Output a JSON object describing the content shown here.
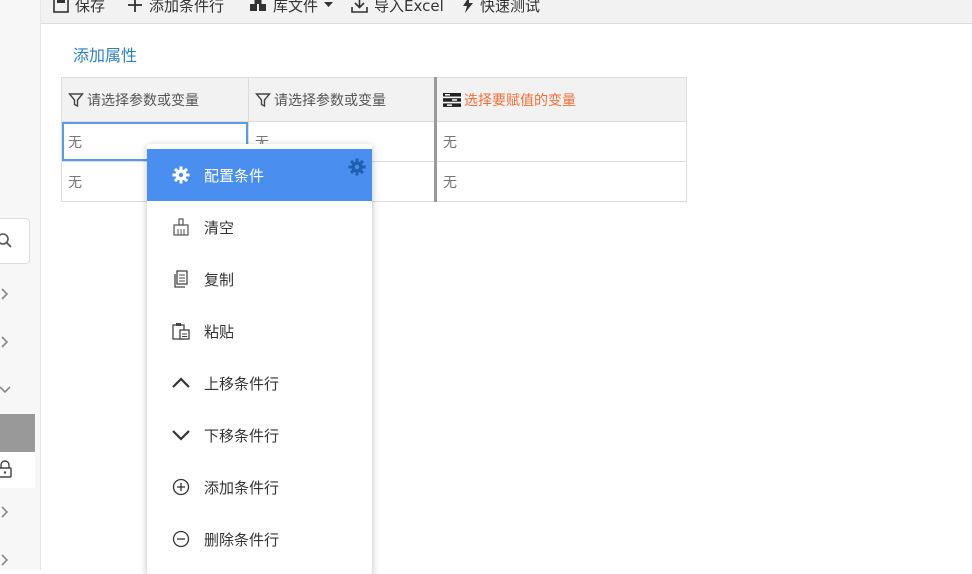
{
  "toolbar": {
    "save": "保存",
    "add_condition_row": "添加条件行",
    "library_file": "库文件",
    "import_excel": "导入Excel",
    "quick_test": "快速测试"
  },
  "add_attribute_link": "添加属性",
  "table": {
    "headers": [
      "请选择参数或变量",
      "请选择参数或变量",
      "选择要赋值的变量"
    ],
    "rows": [
      [
        "无",
        "无",
        "无"
      ],
      [
        "无",
        "",
        "无"
      ]
    ]
  },
  "context_menu": {
    "items": [
      {
        "label": "配置条件",
        "icon": "gear-icon",
        "active": true
      },
      {
        "label": "清空",
        "icon": "broom-icon"
      },
      {
        "label": "复制",
        "icon": "copy-icon"
      },
      {
        "label": "粘贴",
        "icon": "paste-icon"
      },
      {
        "label": "上移条件行",
        "icon": "chevron-up-icon"
      },
      {
        "label": "下移条件行",
        "icon": "chevron-down-icon"
      },
      {
        "label": "添加条件行",
        "icon": "plus-circle-icon"
      },
      {
        "label": "删除条件行",
        "icon": "minus-circle-icon"
      }
    ]
  },
  "colors": {
    "accent": "#4a8ef0",
    "link": "#2f7fc1",
    "action_header": "#f0703a"
  }
}
